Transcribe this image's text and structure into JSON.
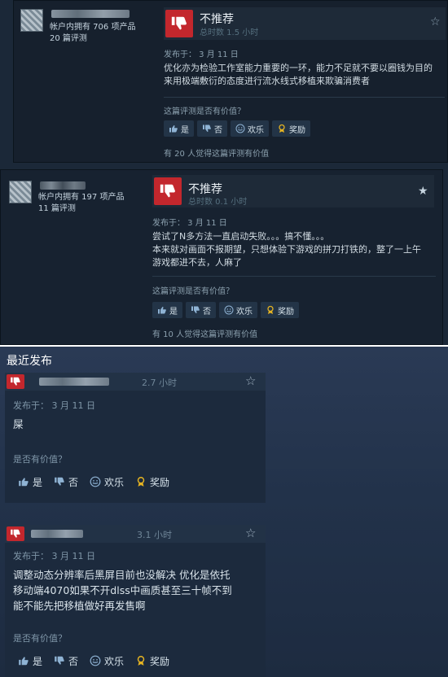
{
  "reviews_top": [
    {
      "owned": "帐户内拥有 706 项产品",
      "reviews_count": "20 篇评测",
      "verdict": "不推荐",
      "hours": "总时数 1.5 小时",
      "posted": "发布于： 3 月 11 日",
      "text_line1": "优化亦为检验工作室能力重要的一环，能力不足就不要以圈钱为目的",
      "text_line2": "来用极端敷衍的态度进行流水线式移植来欺骗消费者",
      "helpful_question": "这篇评测是否有价值？",
      "votes": {
        "yes": "是",
        "no": "否",
        "funny": "欢乐",
        "award": "奖励"
      },
      "helped": "有 20 人觉得这篇评测有价值"
    },
    {
      "owned": "帐户内拥有 197 项产品",
      "reviews_count": "11 篇评测",
      "verdict": "不推荐",
      "hours": "总时数 0.1 小时",
      "posted": "发布于： 3 月 11 日",
      "text_line1": "尝试了N多方法一直启动失败。。。搞不懂。。。",
      "text_line2": "本来就对画面不报期望，只想体验下游戏的拼刀打铁的，整了一上午",
      "text_line3": "游戏都进不去，人麻了",
      "helpful_question": "这篇评测是否有价值？",
      "votes": {
        "yes": "是",
        "no": "否",
        "funny": "欢乐",
        "award": "奖励"
      },
      "helped": "有 10 人觉得这篇评测有价值"
    }
  ],
  "recent": {
    "title": "最近发布",
    "items": [
      {
        "hours": "2.7 小时",
        "posted": "发布于： 3 月 11 日",
        "text_line1": "屎",
        "helpful_question": "是否有价值？",
        "votes": {
          "yes": "是",
          "no": "否",
          "funny": "欢乐",
          "award": "奖励"
        }
      },
      {
        "hours": "3.1 小时",
        "posted": "发布于： 3 月 11 日",
        "text_line1": "调整动态分辨率后黑屏目前也没解决 优化是依托",
        "text_line2": "移动端4070如果不开dlss中画质甚至三十帧不到",
        "text_line3": "能不能先把移植做好再发售啊",
        "helpful_question": "是否有价值？",
        "votes": {
          "yes": "是",
          "no": "否",
          "funny": "欢乐",
          "award": "奖励"
        }
      }
    ]
  },
  "colors": {
    "thumb_down_red": "#c3272d",
    "award_gold": "#e6b422",
    "background": "#1b2838"
  },
  "icons": [
    "thumbs-down-icon",
    "thumbs-up-icon",
    "smile-icon",
    "award-icon",
    "star-icon"
  ]
}
